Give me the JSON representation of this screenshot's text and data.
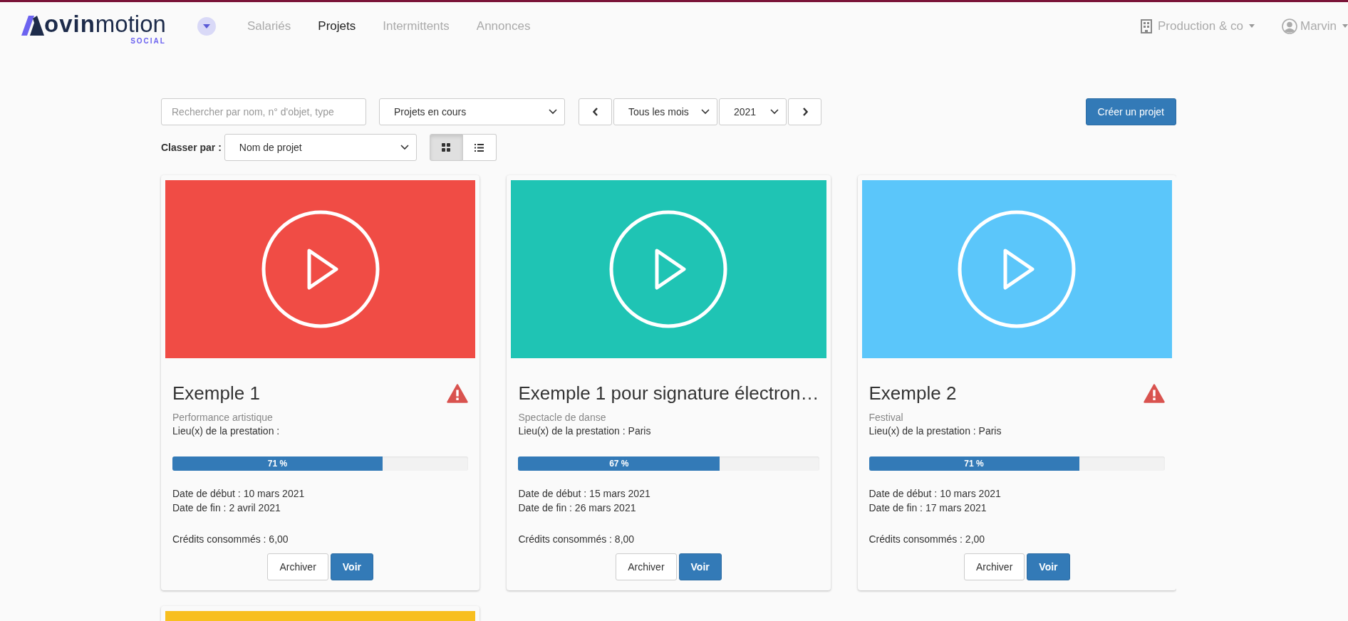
{
  "logo": {
    "bold": "ovin",
    "light": "motion",
    "tag": "SOCIAL"
  },
  "nav": [
    {
      "label": "Salariés",
      "selected": false
    },
    {
      "label": "Projets",
      "selected": true
    },
    {
      "label": "Intermittents",
      "selected": false
    },
    {
      "label": "Annonces",
      "selected": false
    }
  ],
  "company": {
    "label": "Production & co"
  },
  "user": {
    "label": "Marvin"
  },
  "search": {
    "placeholder": "Rechercher par nom, n° d'objet, type"
  },
  "status_select": {
    "value": "Projets en cours"
  },
  "month_select": {
    "value": "Tous les mois"
  },
  "year_select": {
    "value": "2021"
  },
  "create_button": "Créer un projet",
  "sort": {
    "label": "Classer par :",
    "value": "Nom de projet"
  },
  "views": [
    {
      "kind": "grid",
      "selected": true
    },
    {
      "kind": "list",
      "selected": false
    }
  ],
  "projects": [
    {
      "color": "#f04c45",
      "title": "Exemple 1",
      "warning": true,
      "type": "Performance artistique",
      "place": "Lieu(x) de la prestation :",
      "level": 0.71,
      "percent": "71 %",
      "start": "Date de début : 10 mars 2021",
      "end": "Date de fin : 2 avril 2021",
      "credits": "Crédits consommés : 6,00",
      "buttons": [
        "Archiver",
        "Voir"
      ]
    },
    {
      "color": "#1fc4b4",
      "title": "Exemple 1 pour signature électron…",
      "warning": false,
      "type": "Spectacle de danse",
      "place": "Lieu(x) de la prestation : Paris",
      "level": 0.67,
      "percent": "67 %",
      "start": "Date de début : 15 mars 2021",
      "end": "Date de fin : 26 mars 2021",
      "credits": "Crédits consommés : 8,00",
      "buttons": [
        "Archiver",
        "Voir"
      ]
    },
    {
      "color": "#5bc6fa",
      "title": "Exemple 2",
      "warning": true,
      "type": "Festival",
      "place": "Lieu(x) de la prestation : Paris",
      "level": 0.71,
      "percent": "71 %",
      "start": "Date de début : 10 mars 2021",
      "end": "Date de fin : 17 mars 2021",
      "credits": "Crédits consommés : 2,00",
      "buttons": [
        "Archiver",
        "Voir"
      ]
    },
    {
      "color": "#f8bf1f"
    }
  ]
}
